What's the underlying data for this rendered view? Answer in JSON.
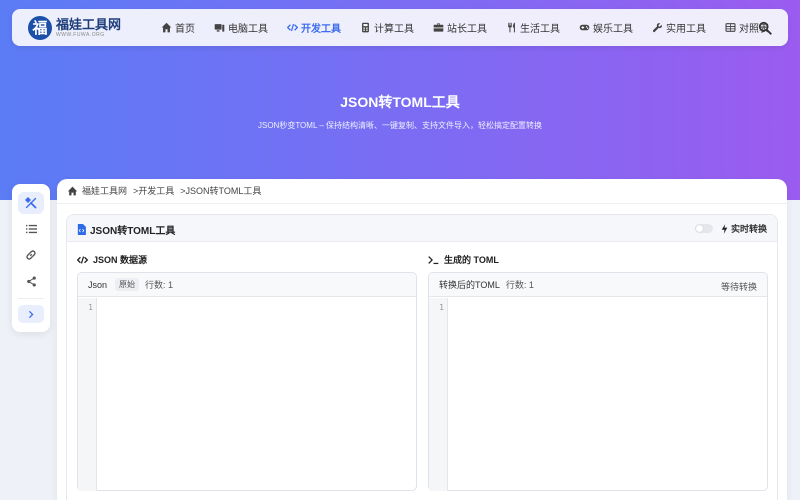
{
  "brand": {
    "name": "福娃工具网",
    "domain": "WWW.FUWA.ORG",
    "mark": "福"
  },
  "nav": {
    "items": [
      {
        "label": "首页",
        "icon": "home-icon"
      },
      {
        "label": "电脑工具",
        "icon": "computer-icon"
      },
      {
        "label": "开发工具",
        "icon": "code-icon",
        "active": true
      },
      {
        "label": "计算工具",
        "icon": "calculator-icon"
      },
      {
        "label": "站长工具",
        "icon": "toolbox-icon"
      },
      {
        "label": "生活工具",
        "icon": "utensils-icon"
      },
      {
        "label": "娱乐工具",
        "icon": "gamepad-icon"
      },
      {
        "label": "实用工具",
        "icon": "wrench-icon"
      },
      {
        "label": "对照表",
        "icon": "table-icon"
      }
    ]
  },
  "hero": {
    "title": "JSON转TOML工具",
    "subtitle": "JSON秒变TOML – 保持结构清晰、一键复制、支持文件导入，轻松搞定配置转换"
  },
  "breadcrumb": [
    "福娃工具网",
    ">开发工具",
    ">JSON转TOML工具"
  ],
  "tool": {
    "title": "JSON转TOML工具",
    "realtime_label": "实时转换",
    "realtime_enabled": false
  },
  "input_pane": {
    "label": "JSON 数据源",
    "editor_name": "Json",
    "badge": "原始",
    "line_count": "行数: 1",
    "line_number": "1"
  },
  "output_pane": {
    "label": "生成的 TOML",
    "editor_name": "转换后的TOML",
    "line_count": "行数: 1",
    "status": "等待转换",
    "line_number": "1"
  },
  "colors": {
    "accent": "#3b6cf0",
    "hero_start": "#5b7cf5",
    "hero_end": "#9b5cf0"
  }
}
